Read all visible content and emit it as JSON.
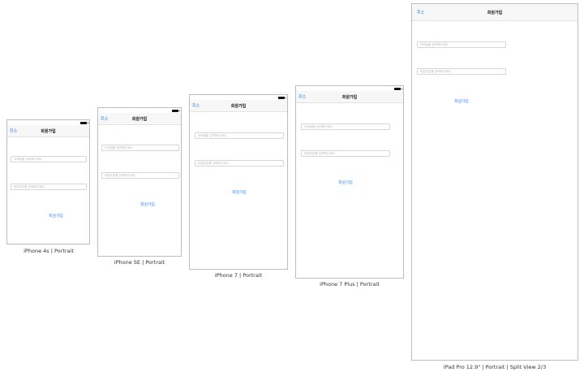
{
  "screen": {
    "nav_cancel": "취소",
    "nav_title": "회원가입",
    "email_placeholder": "이메일을 입력해주세요.",
    "password_placeholder": "비밀번호를 입력해주세요.",
    "signup_button": "회원가입"
  },
  "devices": [
    {
      "label": "iPhone 4s | Portrait"
    },
    {
      "label": "iPhone SE | Portrait"
    },
    {
      "label": "iPhone 7 | Portrait"
    },
    {
      "label": "iPhone 7 Plus | Portrait"
    },
    {
      "label": "iPad Pro 12.9\" | Portrait | Split View 2/3"
    }
  ],
  "colors": {
    "link": "#2d7ff9",
    "border": "#bdbdbd"
  }
}
